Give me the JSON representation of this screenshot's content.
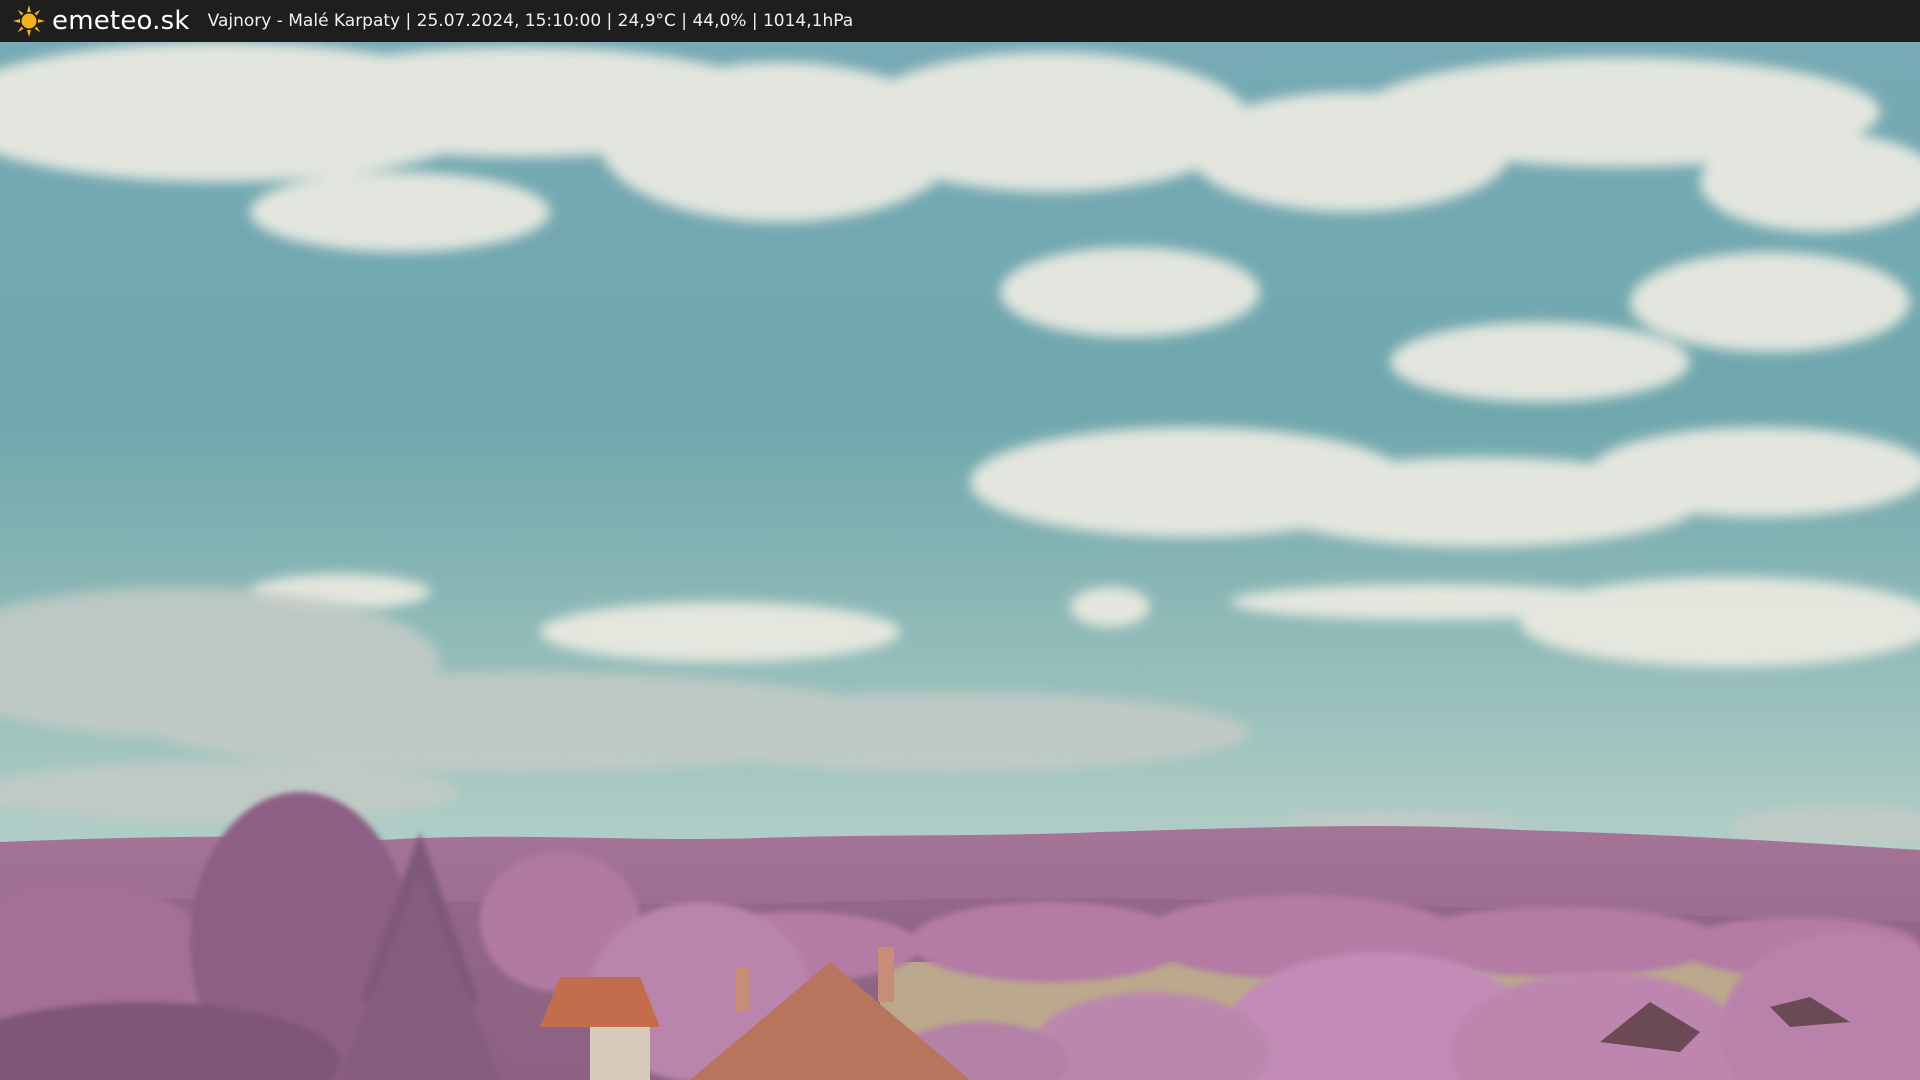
{
  "header": {
    "site_name": "emeteo.sk",
    "logo_icon": "sun-icon",
    "caption": "Vajnory - Malé Karpaty | 25.07.2024, 15:10:00 | 24,9°C | 44,0% | 1014,1hPa"
  },
  "colors": {
    "header_bg": "#1e1e1e",
    "sun": "#f6b21b",
    "sky_top": "#7eb1b7",
    "sky_bottom": "#a9c7c2",
    "foliage": "#b57aa6",
    "hills": "#9c6f8d",
    "roof": "#c06a4b",
    "field": "#b8a589"
  }
}
